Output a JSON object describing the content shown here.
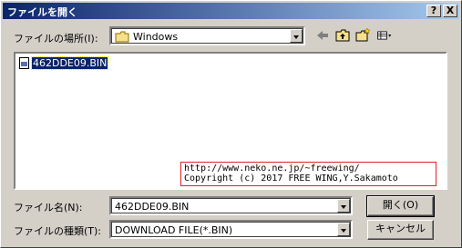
{
  "window": {
    "title": "ファイルを開く",
    "help_label": "?",
    "close_label": "X"
  },
  "lookin": {
    "label": "ファイルの場所(I):",
    "value": "Windows"
  },
  "toolbar": {
    "icons": [
      "back-arrow-icon",
      "up-folder-icon",
      "new-folder-icon",
      "view-menu-icon"
    ]
  },
  "files": [
    {
      "name": "462DDE09.BIN",
      "selected": true
    }
  ],
  "watermark": {
    "line1": "http://www.neko.ne.jp/~freewing/",
    "line2": "Copyright (c) 2017 FREE WING,Y.Sakamoto"
  },
  "filename": {
    "label": "ファイル名(N):",
    "value": "462DDE09.BIN"
  },
  "filetype": {
    "label": "ファイルの種類(T):",
    "value": "DOWNLOAD FILE(*.BIN)"
  },
  "buttons": {
    "open_label": "開く(O)",
    "cancel_label": "キャンセル"
  },
  "colors": {
    "titlebar_start": "#0a246a",
    "titlebar_end": "#a6caf0",
    "selection": "#0a246a",
    "watermark_border": "#e02020"
  }
}
